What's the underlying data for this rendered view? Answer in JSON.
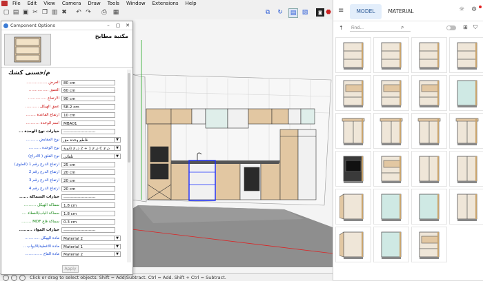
{
  "menu": [
    "File",
    "Edit",
    "View",
    "Camera",
    "Draw",
    "Tools",
    "Window",
    "Extensions",
    "Help"
  ],
  "dialog": {
    "title": "Component Options",
    "component_name": "مكتبة مطابخ",
    "author": "م/حسنى كشك",
    "apply_label": "Apply",
    "rows": [
      {
        "label": "العرض .................",
        "value": "80 cm",
        "color": "red",
        "type": "text"
      },
      {
        "label": "العمق ................",
        "value": "60 cm",
        "color": "red",
        "type": "text"
      },
      {
        "label": "الارتفاع ...............",
        "value": "90 cm",
        "color": "red",
        "type": "text"
      },
      {
        "label": "عمق الهيكل ...........",
        "value": "58.2 cm",
        "color": "red",
        "type": "text"
      },
      {
        "label": "ارتفاع القاعدة ........",
        "value": "10 cm",
        "color": "red",
        "type": "text"
      },
      {
        "label": "اسم الوحدة ...........",
        "value": "MBA01",
        "color": "red",
        "type": "text"
      },
      {
        "label": "خيارات نوع الوحدة ...",
        "value": "-----------------------",
        "color": "blk",
        "type": "text"
      },
      {
        "label": "نوع المقابض ..........",
        "value": "قاطع وحدة مق",
        "color": "blue",
        "type": "select"
      },
      {
        "label": "نوع الوحدة ..........",
        "value": "درج 1 + 2 درج ثانوية C درج",
        "color": "blue",
        "type": "select"
      },
      {
        "label": "نوع الغلق ( الادراج)",
        "value": "تلقائي",
        "color": "blue",
        "type": "select"
      },
      {
        "label": "ارتفاع الدرج رقم 1 (العلوى)",
        "value": "25 cm",
        "color": "blue",
        "type": "text"
      },
      {
        "label": "ارتفاع الدرج رقم 2",
        "value": "20 cm",
        "color": "blue",
        "type": "text"
      },
      {
        "label": "ارتفاع الدرج رقم 3",
        "value": "20 cm",
        "color": "blue",
        "type": "text"
      },
      {
        "label": "ارتفاع الدرج رقم 4",
        "value": "20 cm",
        "color": "blue",
        "type": "text"
      },
      {
        "label": "خيارات السماكة ......",
        "value": "-----------------------",
        "color": "blk",
        "type": "text"
      },
      {
        "label": "سماكة الهيكل ..........",
        "value": "1.8 cm",
        "color": "green",
        "type": "text"
      },
      {
        "label": "سماكة الباب/الغطاء ....",
        "value": "1.8 cm",
        "color": "green",
        "type": "text"
      },
      {
        "label": "سماكة قاع MDF ........",
        "value": "0.3 cm",
        "color": "green",
        "type": "text"
      },
      {
        "label": "خيارات المواد .........",
        "value": "-----------------------",
        "color": "blk",
        "type": "text"
      },
      {
        "label": "مادة الهيكل ............",
        "value": "Material 2",
        "color": "blue",
        "type": "select"
      },
      {
        "label": "مادة الاغطية/الابواب ..",
        "value": "Material 1",
        "color": "blue",
        "type": "select"
      },
      {
        "label": "مادة القاع ..............",
        "value": "Material 2",
        "color": "blue",
        "type": "select"
      }
    ]
  },
  "status": {
    "text": "Click or drag to select objects. Shift = Add/Subtract. Ctrl = Add. Shift + Ctrl = Subtract."
  },
  "panel": {
    "tabs": [
      "MODEL",
      "MATERIAL"
    ],
    "active_tab": "MODEL",
    "search_placeholder": "Find..."
  },
  "colors": {
    "accent": "#1f6fd1",
    "tab_active_bg": "#e3eefb",
    "wood": "#e2c7a2",
    "cabinet_white": "#f1f1f1",
    "floor": "#8e8e8e",
    "select_blue": "#1a2cff"
  },
  "icons": [
    "menu-icon",
    "theme-icon",
    "settings-icon",
    "arrow-up-icon",
    "search-icon",
    "toggle-icon",
    "grid-icon",
    "filter-icon"
  ]
}
